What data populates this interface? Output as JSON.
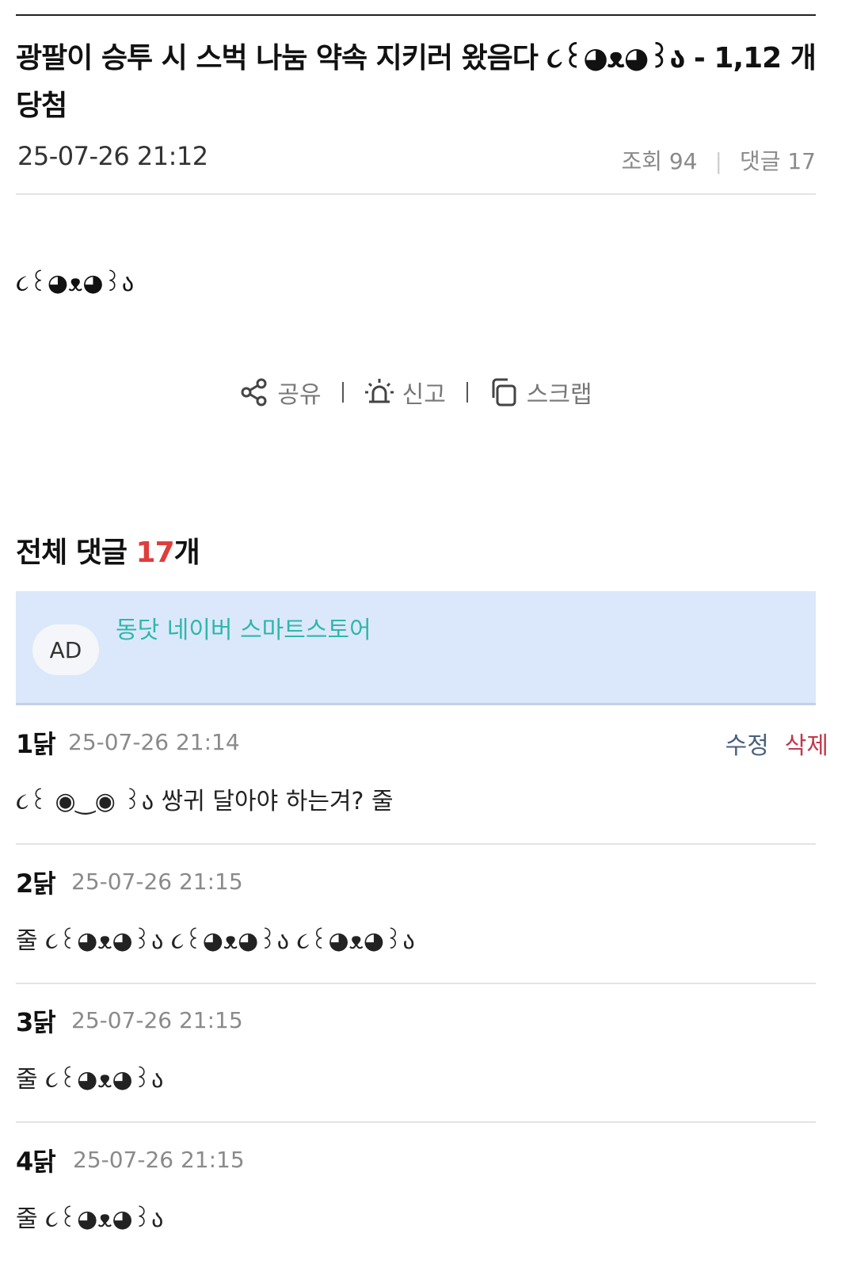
{
  "post": {
    "title": "광팔이 승투 시 스벅 나눔 약속 지키러 왔음다 ૮꒰◕ᴥ◕꒱ა - 1,12 개 당첨",
    "date": "25-07-26 21:12",
    "views_label": "조회 94",
    "comments_label": "댓글 17",
    "body": "૮꒰◕ᴥ◕꒱ა"
  },
  "actions": {
    "share": "공유",
    "report": "신고",
    "scrap": "스크랩"
  },
  "comments_heading": {
    "prefix": "전체 댓글 ",
    "count": "17",
    "suffix": "개"
  },
  "ad": {
    "badge": "AD",
    "text": "동닷 네이버 스마트스토어"
  },
  "comment_actions": {
    "edit": "수정",
    "delete": "삭제"
  },
  "comments": [
    {
      "author": "1닭",
      "date": "25-07-26 21:14",
      "text": "૮꒰ ◉‿◉ ꒱ა 쌍귀 달아야 하는겨? 줄"
    },
    {
      "author": "2닭",
      "date": "25-07-26 21:15",
      "text": "줄 ૮꒰◕ᴥ◕꒱ა ૮꒰◕ᴥ◕꒱ა ૮꒰◕ᴥ◕꒱ა"
    },
    {
      "author": "3닭",
      "date": "25-07-26 21:15",
      "text": "줄 ૮꒰◕ᴥ◕꒱ა"
    },
    {
      "author": "4닭",
      "date": "25-07-26 21:15",
      "text": "줄 ૮꒰◕ᴥ◕꒱ა"
    }
  ],
  "icons": {
    "share": "share-icon",
    "report": "siren-icon",
    "scrap": "copy-icon"
  },
  "colors": {
    "accent_red": "#e03c3c",
    "ad_background": "#dbe8fb",
    "ad_text": "#2fb7aa",
    "edit": "#4a6080",
    "delete": "#c0394b"
  }
}
